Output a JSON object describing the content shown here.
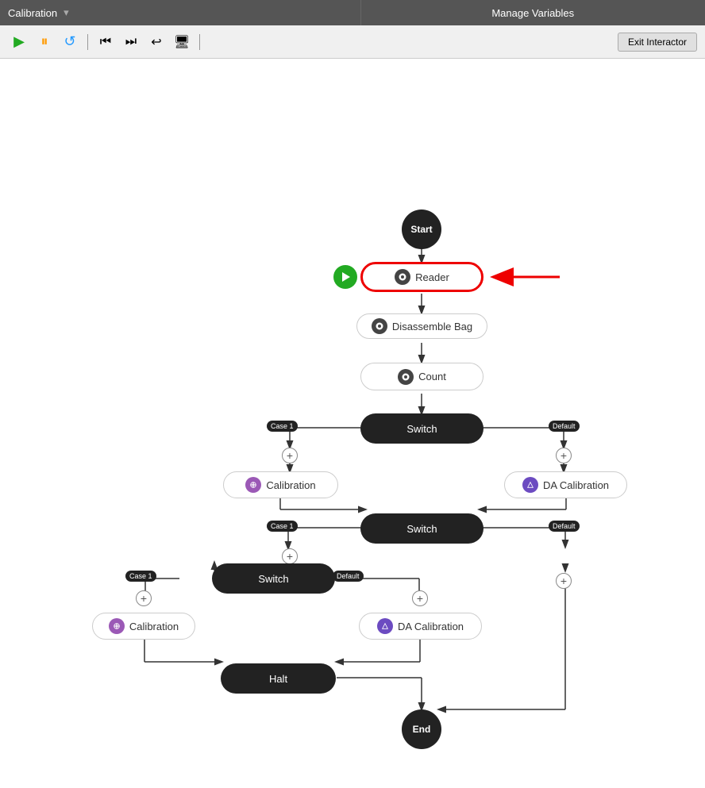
{
  "header": {
    "title": "Calibration",
    "manage_variables": "Manage Variables",
    "exit_button": "Exit Interactor"
  },
  "toolbar": {
    "play_label": "▶",
    "pause_label": "⏸",
    "refresh_label": "↺",
    "step_into_label": "⏭",
    "step_over_label": "⏭",
    "step_back_label": "◀",
    "camera_label": "📷"
  },
  "nodes": {
    "start": "Start",
    "reader": "Reader",
    "disassemble_bag": "Disassemble Bag",
    "count": "Count",
    "switch1": "Switch",
    "switch2": "Switch",
    "switch3": "Switch",
    "calibration1": "Calibration",
    "da_calibration1": "DA Calibration",
    "calibration2": "Calibration",
    "da_calibration2": "DA Calibration",
    "halt": "Halt",
    "end": "End",
    "case1": "Case 1",
    "default": "Default"
  }
}
